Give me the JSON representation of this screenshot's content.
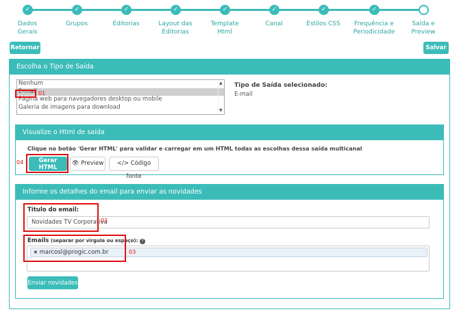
{
  "wizard": {
    "steps": [
      {
        "label": "Dados\nGerais",
        "check": "✓"
      },
      {
        "label": "Grupos",
        "check": "✓"
      },
      {
        "label": "Editorias",
        "check": "✓"
      },
      {
        "label": "Layout das\nEditorias",
        "check": "✓"
      },
      {
        "label": "Template\nHtml",
        "check": "✓"
      },
      {
        "label": "Canal",
        "check": "✓"
      },
      {
        "label": "Estilos CSS",
        "check": "✓"
      },
      {
        "label": "Frequência e\nPeriodicidade",
        "check": "✓"
      },
      {
        "label": "Saída e\nPreview",
        "check": ""
      }
    ]
  },
  "toolbar": {
    "back_label": "Retornar",
    "save_label": "Salvar"
  },
  "output_panel": {
    "title": "Escolha o Tipo de Saída",
    "options": [
      "Nenhum",
      "E-mail",
      "Página web para navegadores desktop ou mobile",
      "Galeria de imagens para download"
    ],
    "selected_title": "Tipo de Saída selecionado:",
    "selected_value": "E-mail"
  },
  "html_panel": {
    "title": "Visualize o Html de saída",
    "instruction": "Clique no botão 'Gerar HTML' para validar e carregar em um HTML todas as escolhas dessa saída multicanal",
    "generate_label": "Gerar HTML",
    "preview_label": "Preview",
    "source_label": "Código fonte"
  },
  "email_panel": {
    "title": "Informe os detalhes do email para enviar as novidades",
    "subject_label": "Titulo do email:",
    "subject_value": "Novidades TV Corporativa",
    "emails_label": "Emails",
    "emails_hint": "(separar por virgula ou espaço):",
    "email_tags": [
      "marcosl@progic.com.br"
    ],
    "send_label": "Enviar novidades"
  },
  "annotations": [
    "01",
    "02",
    "03",
    "04"
  ],
  "colors": {
    "accent": "#3cbcb9",
    "annotation": "#e01010"
  }
}
